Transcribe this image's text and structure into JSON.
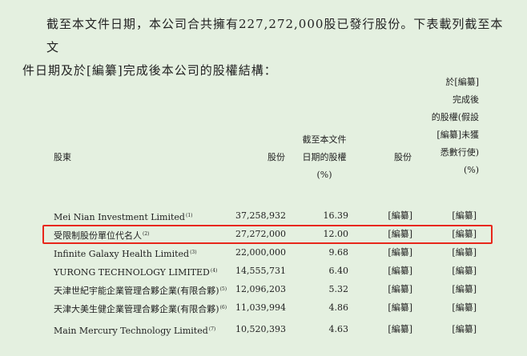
{
  "intro": {
    "line1": "截至本文件日期，本公司合共擁有227,272,000股已發行股份。下表載列截至本文",
    "line2": "件日期及於[編纂]完成後本公司的股權結構："
  },
  "table": {
    "headers": {
      "shareholder": "股東",
      "shares": "股份",
      "pct_now": [
        "截至本文件",
        "日期的股權",
        "(%)"
      ],
      "shares_after": "股份",
      "pct_after": [
        "於[編纂]",
        "完成後",
        "的股權(假設",
        "[編纂]未獲",
        "悉數行使)",
        "(%)"
      ]
    },
    "rows": [
      {
        "name": "Mei Nian Investment Limited",
        "note": "(1)",
        "shares": "37,258,932",
        "pct": "16.39",
        "shares_after": "[編纂]",
        "pct_after": "[編纂]"
      },
      {
        "name": "受限制股份單位代名人",
        "note": "(2)",
        "shares": "27,272,000",
        "pct": "12.00",
        "shares_after": "[編纂]",
        "pct_after": "[編纂]"
      },
      {
        "name": "Infinite Galaxy Health Limited",
        "note": "(3)",
        "shares": "22,000,000",
        "pct": "9.68",
        "shares_after": "[編纂]",
        "pct_after": "[編纂]"
      },
      {
        "name": "YURONG TECHNOLOGY LIMITED",
        "note": "(4)",
        "shares": "14,555,731",
        "pct": "6.40",
        "shares_after": "[編纂]",
        "pct_after": "[編纂]"
      },
      {
        "name": "天津世紀宇能企業管理合夥企業(有限合夥)",
        "note": "(5)",
        "shares": "12,096,203",
        "pct": "5.32",
        "shares_after": "[編纂]",
        "pct_after": "[編纂]"
      },
      {
        "name": "天津大美生健企業管理合夥企業(有限合夥)",
        "note": "(6)",
        "shares": "11,039,994",
        "pct": "4.86",
        "shares_after": "[編纂]",
        "pct_after": "[編纂]"
      },
      {
        "name": "Main Mercury Technology Limited",
        "note": "(7)",
        "shares": "10,520,393",
        "pct": "4.63",
        "shares_after": "[編纂]",
        "pct_after": "[編纂]"
      }
    ]
  },
  "colors": {
    "background": "#e4f0e0",
    "highlight": "#e8271b"
  }
}
